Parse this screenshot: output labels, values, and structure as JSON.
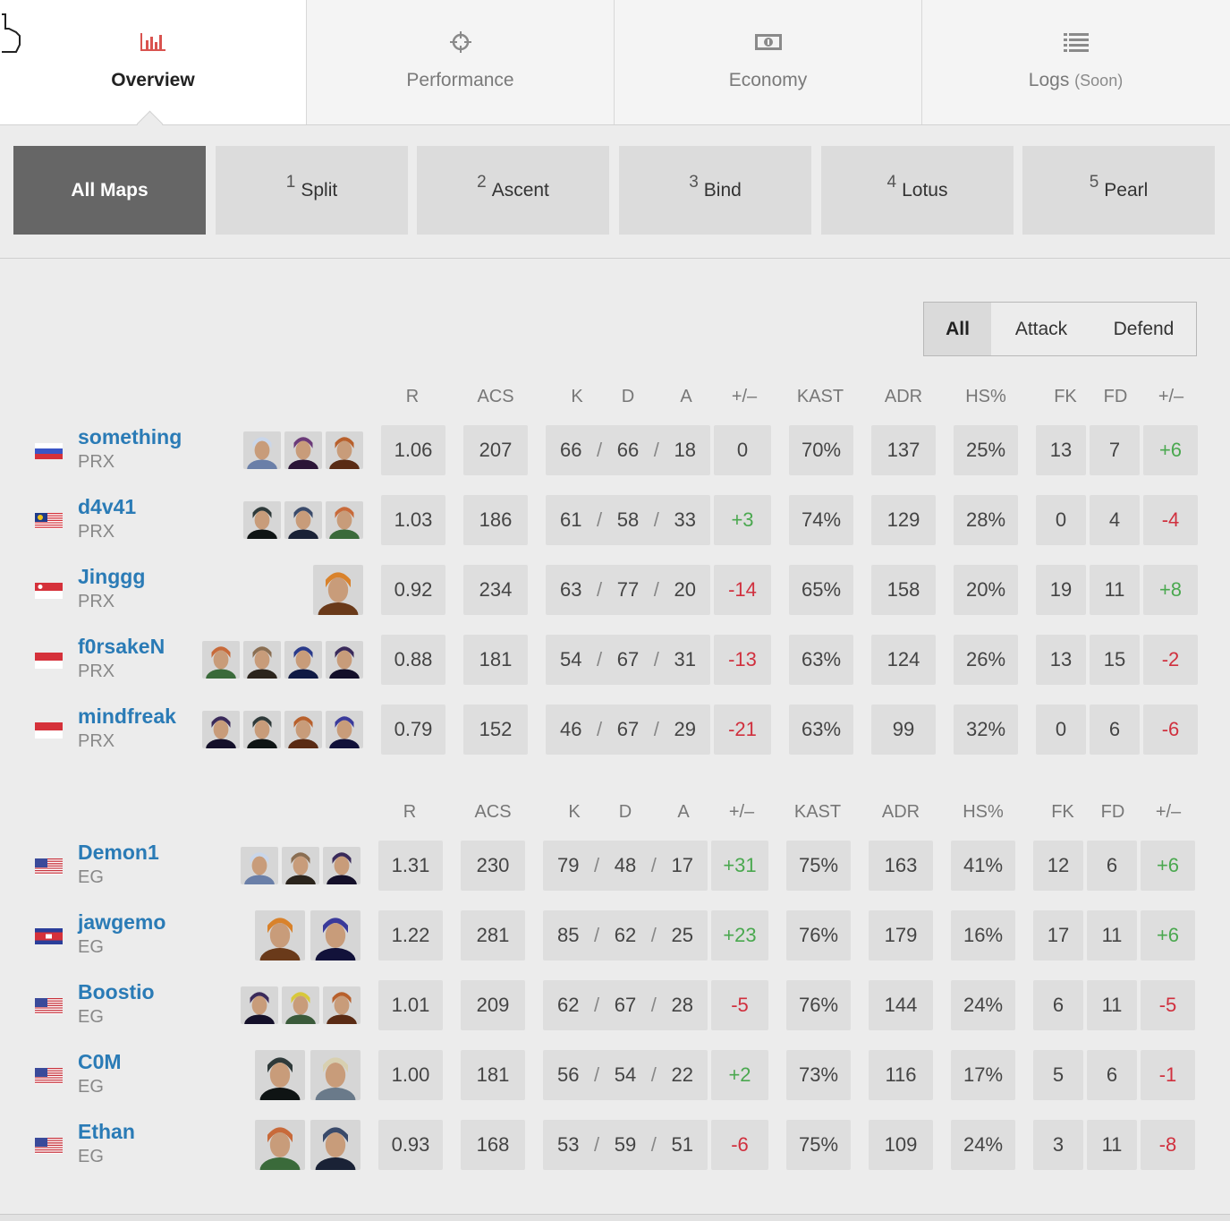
{
  "tabs": [
    {
      "label": "Overview",
      "icon": "bar-chart-icon",
      "active": true
    },
    {
      "label": "Performance",
      "icon": "crosshair-icon"
    },
    {
      "label": "Economy",
      "icon": "money-icon"
    },
    {
      "label": "Logs",
      "suffix": "(Soon)",
      "icon": "list-icon"
    }
  ],
  "maps": [
    {
      "num": "",
      "label": "All Maps",
      "active": true
    },
    {
      "num": "1",
      "label": "Split"
    },
    {
      "num": "2",
      "label": "Ascent"
    },
    {
      "num": "3",
      "label": "Bind"
    },
    {
      "num": "4",
      "label": "Lotus"
    },
    {
      "num": "5",
      "label": "Pearl"
    }
  ],
  "side_filter": {
    "all": "All",
    "attack": "Attack",
    "defend": "Defend"
  },
  "columns": {
    "r": "R",
    "acs": "ACS",
    "k": "K",
    "d": "D",
    "a": "A",
    "pm": "+/–",
    "kast": "KAST",
    "adr": "ADR",
    "hs": "HS%",
    "fk": "FK",
    "fd": "FD",
    "fpm": "+/–"
  },
  "colors": {
    "link": "#2a7bb6",
    "positive": "#4aa84f",
    "negative": "#d0303e",
    "cell": "#dedede"
  },
  "teams": [
    {
      "name": "PRX",
      "players": [
        {
          "name": "something",
          "team": "PRX",
          "flag": "ru",
          "agents": [
            "jett",
            "reyna",
            "breach"
          ],
          "r": "1.06",
          "acs": "207",
          "k": "66",
          "d": "66",
          "a": "18",
          "pm": "0",
          "kast": "70%",
          "adr": "137",
          "hs": "25%",
          "fk": "13",
          "fd": "7",
          "fpm": "+6"
        },
        {
          "name": "d4v41",
          "team": "PRX",
          "flag": "my",
          "agents": [
            "viper",
            "kayo",
            "skye"
          ],
          "r": "1.03",
          "acs": "186",
          "k": "61",
          "d": "58",
          "a": "33",
          "pm": "+3",
          "kast": "74%",
          "adr": "129",
          "hs": "28%",
          "fk": "0",
          "fd": "4",
          "fpm": "-4"
        },
        {
          "name": "Jinggg",
          "team": "PRX",
          "flag": "sg",
          "agents": [
            "raze"
          ],
          "r": "0.92",
          "acs": "234",
          "k": "63",
          "d": "77",
          "a": "20",
          "pm": "-14",
          "kast": "65%",
          "adr": "158",
          "hs": "20%",
          "fk": "19",
          "fd": "11",
          "fpm": "+8"
        },
        {
          "name": "f0rsakeN",
          "team": "PRX",
          "flag": "id",
          "agents": [
            "skye",
            "chamber",
            "yoru",
            "neon"
          ],
          "r": "0.88",
          "acs": "181",
          "k": "54",
          "d": "67",
          "a": "31",
          "pm": "-13",
          "kast": "63%",
          "adr": "124",
          "hs": "26%",
          "fk": "13",
          "fd": "15",
          "fpm": "-2"
        },
        {
          "name": "mindfreak",
          "team": "PRX",
          "flag": "id",
          "agents": [
            "neon",
            "viper",
            "breach",
            "omen"
          ],
          "r": "0.79",
          "acs": "152",
          "k": "46",
          "d": "67",
          "a": "29",
          "pm": "-21",
          "kast": "63%",
          "adr": "99",
          "hs": "32%",
          "fk": "0",
          "fd": "6",
          "fpm": "-6"
        }
      ]
    },
    {
      "name": "EG",
      "players": [
        {
          "name": "Demon1",
          "team": "EG",
          "flag": "us",
          "agents": [
            "jett",
            "chamber",
            "neon"
          ],
          "r": "1.31",
          "acs": "230",
          "k": "79",
          "d": "48",
          "a": "17",
          "pm": "+31",
          "kast": "75%",
          "adr": "163",
          "hs": "41%",
          "fk": "12",
          "fd": "6",
          "fpm": "+6"
        },
        {
          "name": "jawgemo",
          "team": "EG",
          "flag": "kh",
          "agents": [
            "raze",
            "omen"
          ],
          "r": "1.22",
          "acs": "281",
          "k": "85",
          "d": "62",
          "a": "25",
          "pm": "+23",
          "kast": "76%",
          "adr": "179",
          "hs": "16%",
          "fk": "17",
          "fd": "11",
          "fpm": "+6"
        },
        {
          "name": "Boostio",
          "team": "EG",
          "flag": "us",
          "agents": [
            "neon",
            "killjoy",
            "breach"
          ],
          "r": "1.01",
          "acs": "209",
          "k": "62",
          "d": "67",
          "a": "28",
          "pm": "-5",
          "kast": "76%",
          "adr": "144",
          "hs": "24%",
          "fk": "6",
          "fd": "11",
          "fpm": "-5"
        },
        {
          "name": "C0M",
          "team": "EG",
          "flag": "us",
          "agents": [
            "viper",
            "sova"
          ],
          "r": "1.00",
          "acs": "181",
          "k": "56",
          "d": "54",
          "a": "22",
          "pm": "+2",
          "kast": "73%",
          "adr": "116",
          "hs": "17%",
          "fk": "5",
          "fd": "6",
          "fpm": "-1"
        },
        {
          "name": "Ethan",
          "team": "EG",
          "flag": "us",
          "agents": [
            "skye",
            "kayo"
          ],
          "r": "0.93",
          "acs": "168",
          "k": "53",
          "d": "59",
          "a": "51",
          "pm": "-6",
          "kast": "75%",
          "adr": "109",
          "hs": "24%",
          "fk": "3",
          "fd": "11",
          "fpm": "-8"
        }
      ]
    }
  ]
}
